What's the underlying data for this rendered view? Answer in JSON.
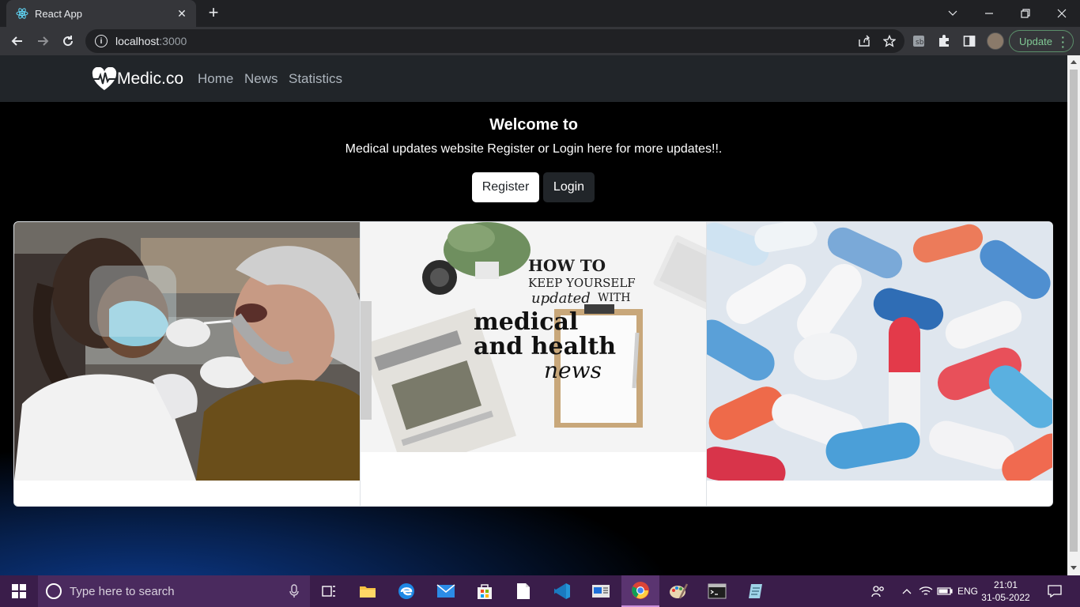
{
  "browser": {
    "tab_title": "React App",
    "url_host": "localhost",
    "url_port": ":3000",
    "update_label": "Update"
  },
  "site": {
    "brand": "Medic.co",
    "nav": [
      "Home",
      "News",
      "Statistics"
    ],
    "hero_title": "Welcome to",
    "hero_subtitle": "Medical updates website Register or Login here for more updates!!.",
    "register_label": "Register",
    "login_label": "Login",
    "cards": [
      {
        "image": "doctor-swab-test-photo"
      },
      {
        "image": "medical-news-graphic",
        "text": [
          "HOW TO",
          "KEEP YOURSELF",
          "updated",
          "WITH",
          "medical",
          "and health",
          "news"
        ]
      },
      {
        "image": "colorful-pills-photo"
      }
    ]
  },
  "taskbar": {
    "search_placeholder": "Type here to search",
    "language": "ENG",
    "time": "21:01",
    "date": "31-05-2022"
  },
  "colors": {
    "site_nav_bg": "#212529",
    "page_bg": "#000000",
    "gradient_blue": "#0c3a8c",
    "taskbar_bg": "#3a1d4a",
    "update_green": "#81c995"
  }
}
